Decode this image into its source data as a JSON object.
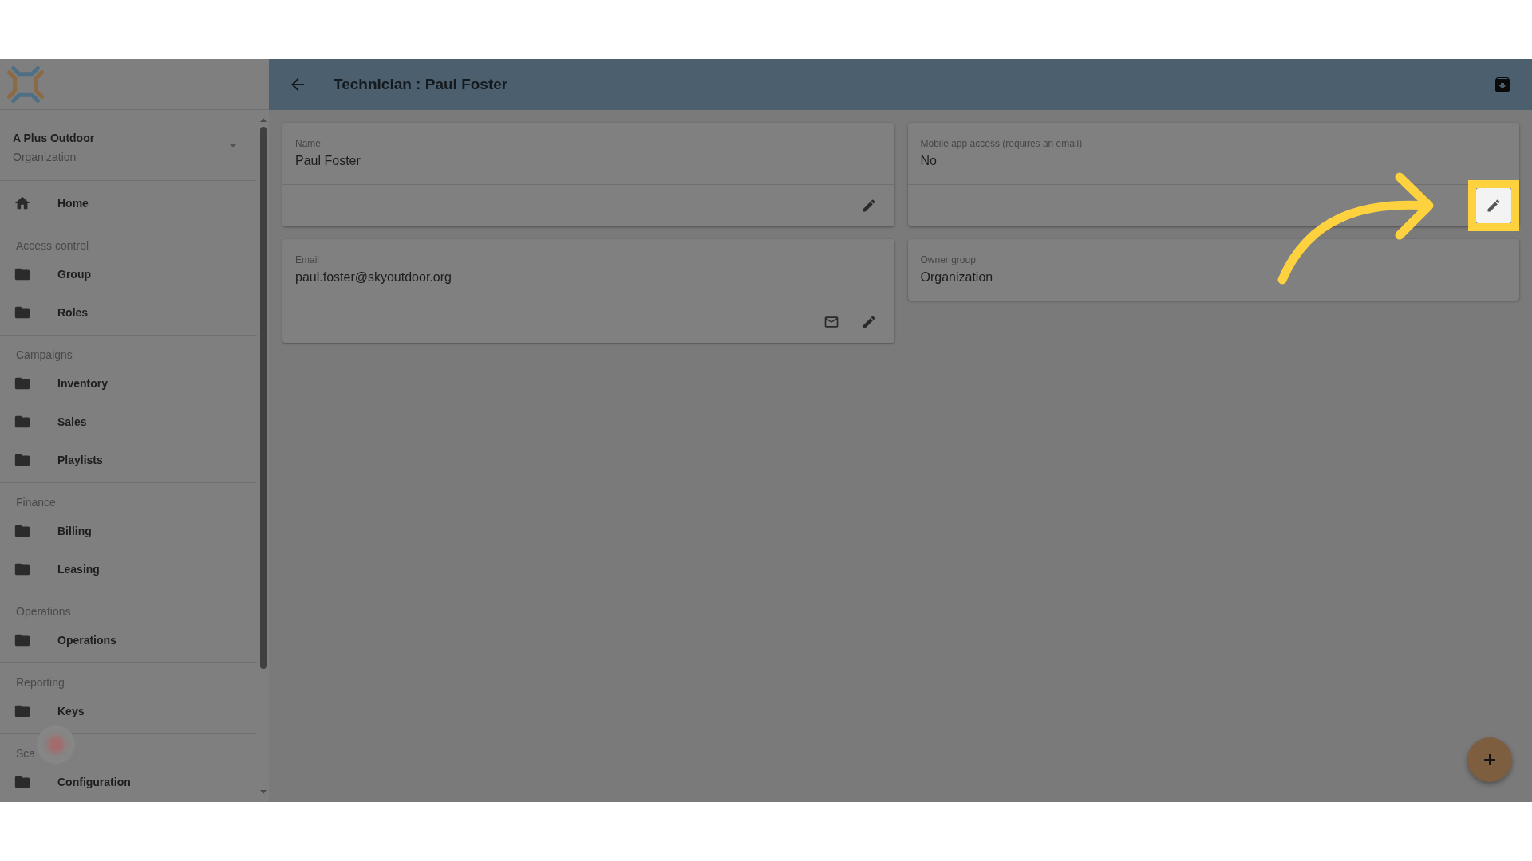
{
  "sidebar": {
    "org_selector": {
      "name": "A Plus Outdoor",
      "type": "Organization"
    },
    "items": [
      {
        "label": "Home",
        "kind": "home"
      }
    ],
    "sections": [
      {
        "title": "Access control",
        "click_marker": false,
        "items": [
          {
            "label": "Group",
            "kind": "folder"
          },
          {
            "label": "Roles",
            "kind": "folder"
          }
        ]
      },
      {
        "title": "Campaigns",
        "click_marker": false,
        "items": [
          {
            "label": "Inventory",
            "kind": "folder"
          },
          {
            "label": "Sales",
            "kind": "folder"
          },
          {
            "label": "Playlists",
            "kind": "folder"
          }
        ]
      },
      {
        "title": "Finance",
        "click_marker": false,
        "items": [
          {
            "label": "Billing",
            "kind": "folder"
          },
          {
            "label": "Leasing",
            "kind": "folder"
          }
        ]
      },
      {
        "title": "Operations",
        "click_marker": false,
        "items": [
          {
            "label": "Operations",
            "kind": "folder"
          }
        ]
      },
      {
        "title": "Reporting",
        "click_marker": false,
        "items": [
          {
            "label": "Keys",
            "kind": "folder"
          }
        ]
      },
      {
        "title": "Sca",
        "click_marker": true,
        "items": [
          {
            "label": "Configuration",
            "kind": "folder"
          }
        ]
      }
    ]
  },
  "header": {
    "title": "Technician : Paul Foster"
  },
  "fields": [
    {
      "label": "Name",
      "value": "Paul Foster",
      "actions": [
        {
          "kind": "edit",
          "highlighted": false
        }
      ]
    },
    {
      "label": "Mobile app access (requires an email)",
      "value": "No",
      "actions": [
        {
          "kind": "edit",
          "highlighted": true
        }
      ]
    },
    {
      "label": "Email",
      "value": "paul.foster@skyoutdoor.org",
      "actions": [
        {
          "kind": "email",
          "highlighted": false
        },
        {
          "kind": "edit",
          "highlighted": false
        }
      ]
    },
    {
      "label": "Owner group",
      "value": "Organization"
    }
  ]
}
